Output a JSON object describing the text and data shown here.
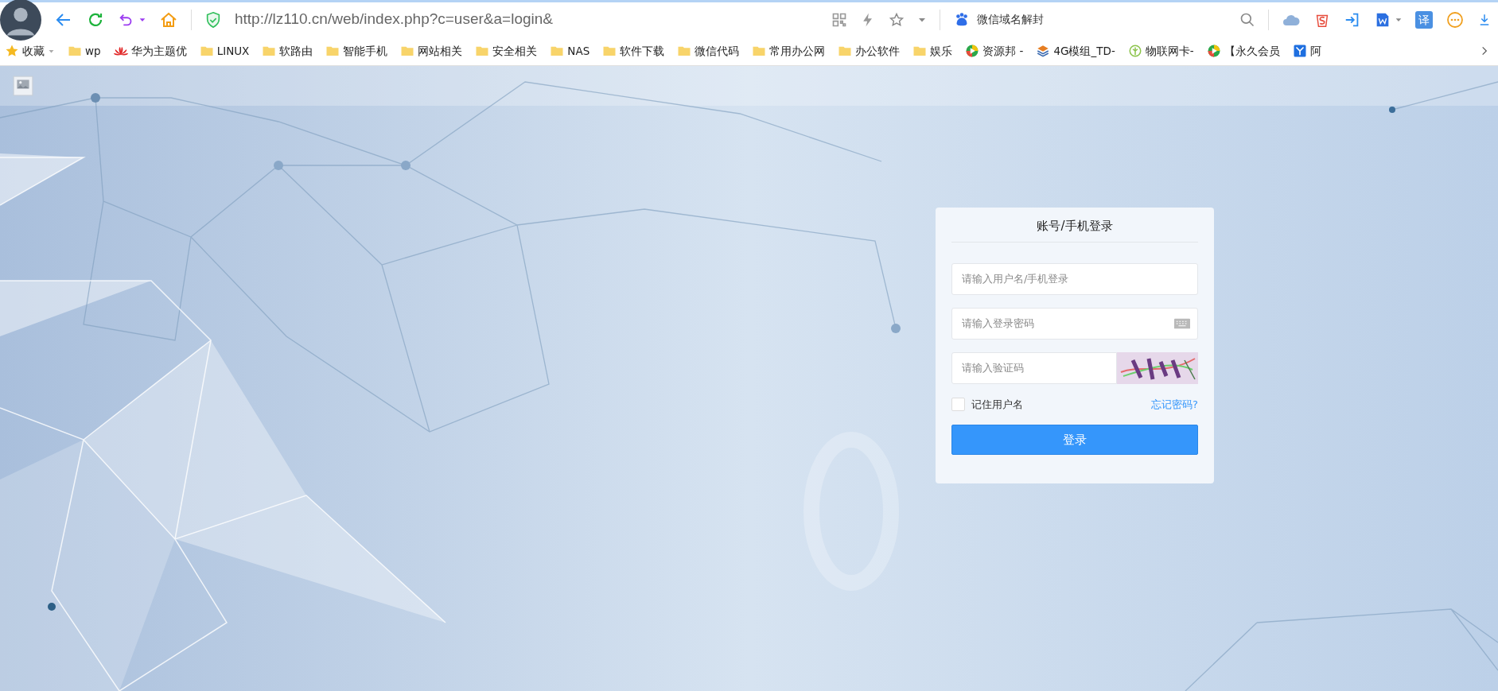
{
  "browser": {
    "url": "http://lz110.cn/web/index.php?c=user&a=login&",
    "search_text": "微信域名解封",
    "translate_button": "译"
  },
  "bookmarks": [
    {
      "label": "收藏",
      "kind": "star"
    },
    {
      "label": "wp",
      "kind": "folder"
    },
    {
      "label": "华为主题优",
      "kind": "petals"
    },
    {
      "label": "LINUX",
      "kind": "folder"
    },
    {
      "label": "软路由",
      "kind": "folder"
    },
    {
      "label": "智能手机",
      "kind": "folder"
    },
    {
      "label": "网站相关",
      "kind": "folder"
    },
    {
      "label": "安全相关",
      "kind": "folder"
    },
    {
      "label": "NAS",
      "kind": "folder"
    },
    {
      "label": "软件下载",
      "kind": "folder"
    },
    {
      "label": "微信代码",
      "kind": "folder"
    },
    {
      "label": "常用办公网",
      "kind": "folder"
    },
    {
      "label": "办公软件",
      "kind": "folder"
    },
    {
      "label": "娱乐",
      "kind": "folder"
    },
    {
      "label": "资源邦 -",
      "kind": "play"
    },
    {
      "label": "4G模组_TD-",
      "kind": "layers"
    },
    {
      "label": "物联网卡-",
      "kind": "leaf"
    },
    {
      "label": "【永久会员",
      "kind": "play"
    },
    {
      "label": "阿",
      "kind": "badge"
    }
  ],
  "login": {
    "title": "账号/手机登录",
    "username": {
      "placeholder": "请输入用户名/手机登录"
    },
    "password": {
      "placeholder": "请输入登录密码"
    },
    "captcha": {
      "placeholder": "请输入验证码"
    },
    "remember": {
      "label": "记住用户名",
      "checked": false
    },
    "forgot_link": "忘记密码?",
    "submit": "登录"
  }
}
